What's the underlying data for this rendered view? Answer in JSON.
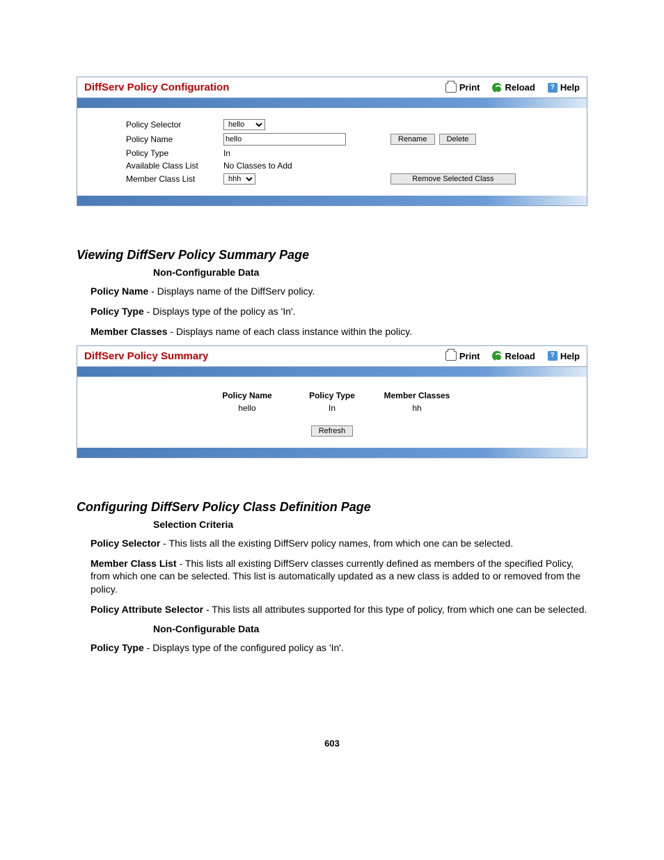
{
  "panel1": {
    "title": "DiffServ Policy Configuration",
    "print": "Print",
    "reload": "Reload",
    "help": "Help",
    "labels": {
      "policy_selector": "Policy Selector",
      "policy_name": "Policy Name",
      "policy_type": "Policy Type",
      "available_class_list": "Available Class List",
      "member_class_list": "Member Class List"
    },
    "values": {
      "policy_selector": "hello",
      "policy_name": "hello",
      "policy_type": "In",
      "available_class_list": "No Classes to Add",
      "member_class_list": "hhh"
    },
    "buttons": {
      "rename": "Rename",
      "delete": "Delete",
      "remove": "Remove Selected Class"
    }
  },
  "section1": {
    "title": "Viewing DiffServ Policy Summary Page",
    "sub": "Non-Configurable Data",
    "desc1a": "Policy Name",
    "desc1b": " - Displays name of the DiffServ policy.",
    "desc2a": "Policy Type",
    "desc2b": " - Displays type of the policy as 'In'.",
    "desc3a": "Member Classes",
    "desc3b": " - Displays name of each class instance within the policy."
  },
  "panel2": {
    "title": "DiffServ Policy Summary",
    "print": "Print",
    "reload": "Reload",
    "help": "Help",
    "headers": {
      "policy_name": "Policy Name",
      "policy_type": "Policy Type",
      "member_classes": "Member Classes"
    },
    "row": {
      "policy_name": "hello",
      "policy_type": "In",
      "member_classes": "hh"
    },
    "refresh": "Refresh"
  },
  "section2": {
    "title": "Configuring DiffServ Policy Class Definition Page",
    "sub1": "Selection Criteria",
    "d1a": "Policy Selector",
    "d1b": " - This lists all the existing DiffServ policy names, from which one can be selected.",
    "d2a": "Member Class List",
    "d2b": " - This lists all existing DiffServ classes currently defined as members of the specified Policy, from which one can be selected. This list is automatically updated as a new class is added to or removed from the policy.",
    "d3a": "Policy Attribute Selector",
    "d3b": " - This lists all attributes supported for this type of policy, from which one can be selected.",
    "sub2": "Non-Configurable Data",
    "d4a": "Policy Type",
    "d4b": " - Displays type of the configured policy as 'In'."
  },
  "page_number": "603"
}
